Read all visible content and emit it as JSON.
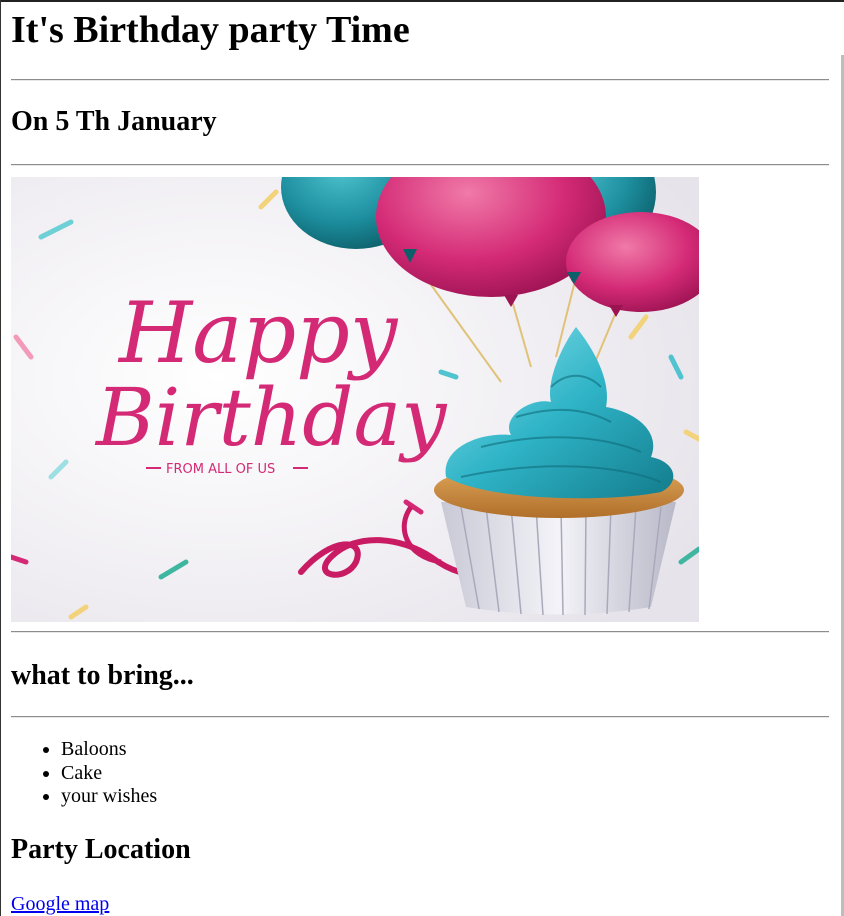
{
  "header": {
    "title": "It's Birthday party Time",
    "date": "On 5 Th January"
  },
  "banner": {
    "headline_line1": "Happy",
    "headline_line2": "Birthday",
    "tagline": "FROM ALL OF US",
    "colors": {
      "background": "#f1eff3",
      "pink": "#d42a76",
      "teal": "#1d8f9f",
      "frosting": "#2fb4c7",
      "cake": "#c98a3f",
      "liner": "#dcdce6"
    }
  },
  "bring": {
    "heading": "what to bring...",
    "items": [
      "Baloons",
      "Cake",
      "your wishes"
    ]
  },
  "location": {
    "heading": "Party Location",
    "link_label": "Google map"
  }
}
